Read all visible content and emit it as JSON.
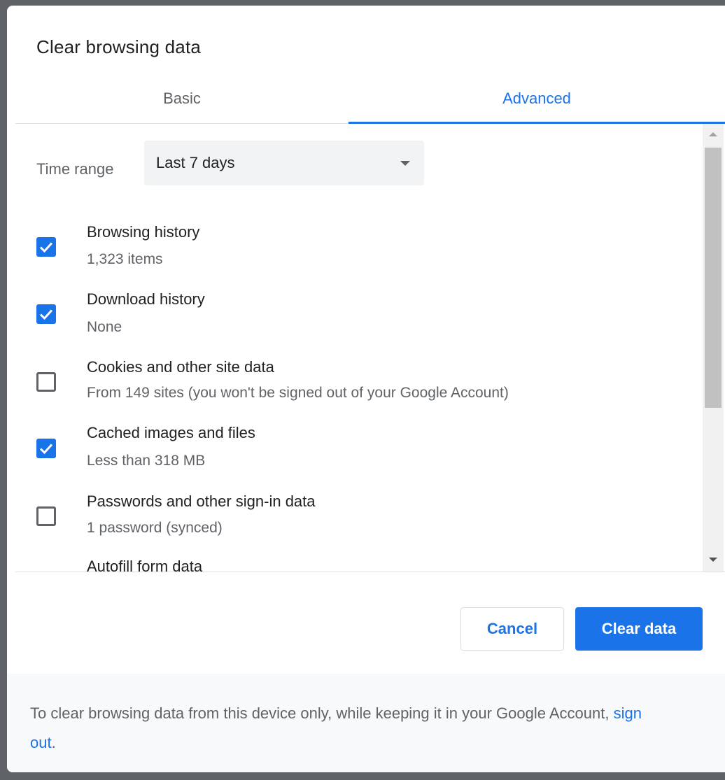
{
  "dialog": {
    "title": "Clear browsing data"
  },
  "tabs": {
    "basic": "Basic",
    "advanced": "Advanced",
    "selected": "Advanced"
  },
  "time_range": {
    "label": "Time range",
    "value": "Last 7 days"
  },
  "options": [
    {
      "title": "Browsing history",
      "subtitle": "1,323 items",
      "checked": true
    },
    {
      "title": "Download history",
      "subtitle": "None",
      "checked": true
    },
    {
      "title": "Cookies and other site data",
      "subtitle": "From 149 sites (you won't be signed out of your Google Account)",
      "checked": false
    },
    {
      "title": "Cached images and files",
      "subtitle": "Less than 318 MB",
      "checked": true
    },
    {
      "title": "Passwords and other sign-in data",
      "subtitle": "1 password (synced)",
      "checked": false
    },
    {
      "title": "Autofill form data",
      "subtitle": "",
      "checked": false
    }
  ],
  "buttons": {
    "cancel": "Cancel",
    "clear": "Clear data"
  },
  "footer": {
    "text_before": "To clear browsing data from this device only, while keeping it in your Google Account, ",
    "link": "sign out",
    "text_after": "."
  },
  "colors": {
    "accent": "#1a73e8",
    "text_primary": "#202124",
    "text_secondary": "#5f6368"
  },
  "icons": {
    "checkmark": "check-icon",
    "dropdown": "dropdown-arrow-icon"
  }
}
